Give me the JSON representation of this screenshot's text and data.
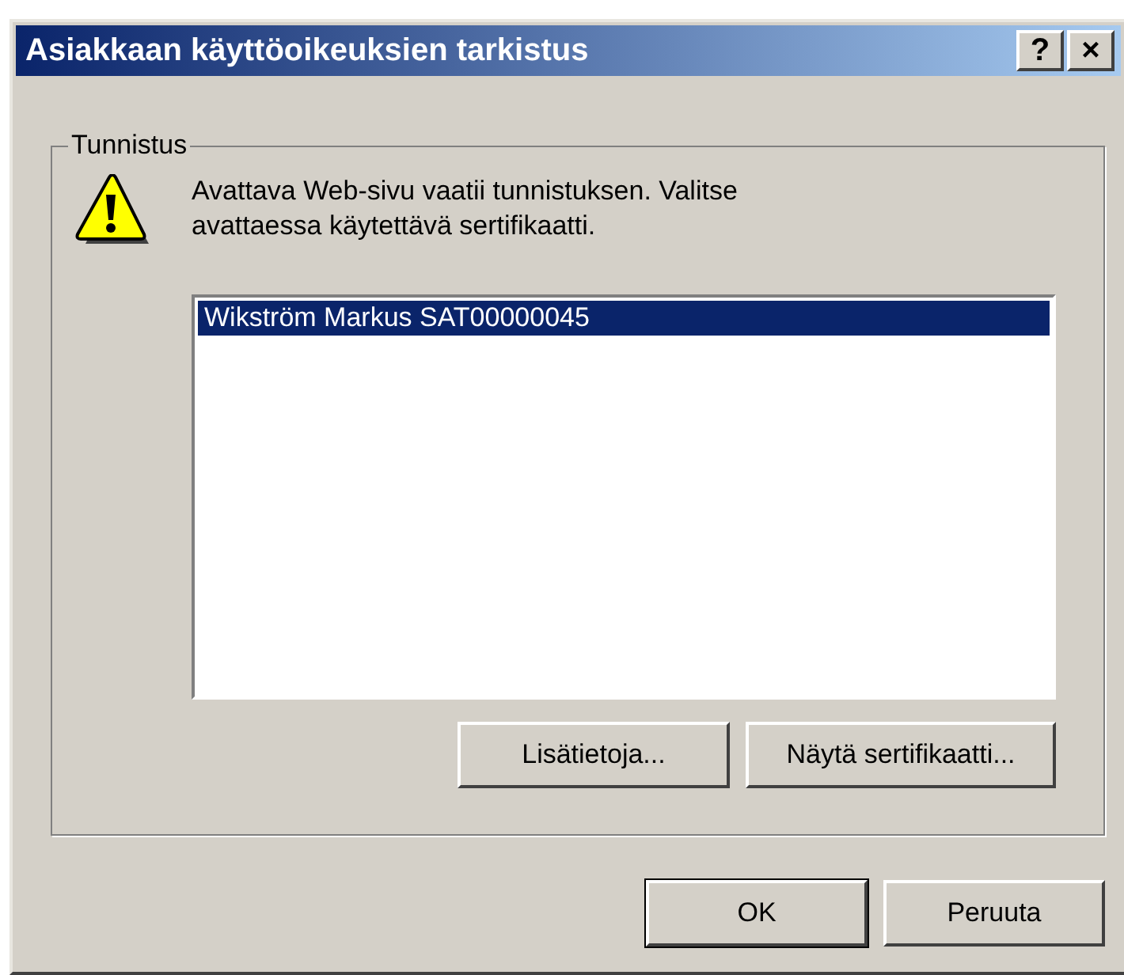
{
  "window": {
    "title": "Asiakkaan käyttöoikeuksien tarkistus",
    "title_buttons": [
      "?",
      "×"
    ]
  },
  "group": {
    "label": "Tunnistus",
    "message": "Avattava Web-sivu vaatii tunnistuksen. Valitse avattaessa käytettävä sertifikaatti.",
    "certificates": [
      {
        "label": "Wikström Markus SAT00000045",
        "selected": true
      }
    ],
    "buttons": [
      {
        "label": "Lisätietoja..."
      },
      {
        "label": "Näytä sertifikaatti..."
      }
    ]
  },
  "buttons": [
    {
      "label": "OK",
      "default": true
    },
    {
      "label": "Peruuta",
      "default": false
    }
  ]
}
